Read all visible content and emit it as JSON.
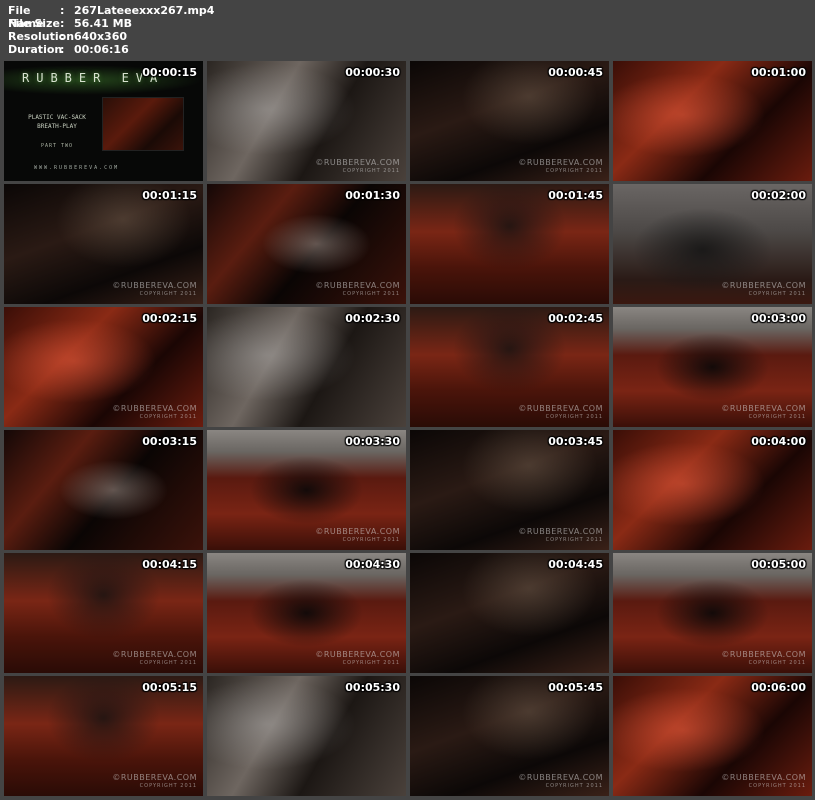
{
  "file_info": {
    "name": {
      "label": "File Name",
      "sep": ":",
      "value": "267Lateeexxx267.mp4"
    },
    "size": {
      "label": "File Size",
      "sep": ":",
      "value": "56.41 MB"
    },
    "resolution": {
      "label": "Resolution",
      "sep": ":",
      "value": "640x360"
    },
    "duration": {
      "label": "Duration",
      "sep": ":",
      "value": "00:06:16"
    }
  },
  "title_card": {
    "logo": "RUBBER EVA",
    "line1": "PLASTIC VAC-SACK",
    "line2": "BREATH-PLAY",
    "part": "PART TWO",
    "url": "WWW.RUBBEREVA.COM"
  },
  "watermark": {
    "brand": "©RUBBEREVA.COM",
    "copyright": "COPYRIGHT 2011"
  },
  "thumbnails": [
    {
      "time": "00:00:15",
      "scene": "title"
    },
    {
      "time": "00:00:30",
      "scene": "plastic"
    },
    {
      "time": "00:00:45",
      "scene": "dark"
    },
    {
      "time": "00:01:00",
      "scene": "red"
    },
    {
      "time": "00:01:15",
      "scene": "dark"
    },
    {
      "time": "00:01:30",
      "scene": "shine"
    },
    {
      "time": "00:01:45",
      "scene": "sofa"
    },
    {
      "time": "00:02:00",
      "scene": "grey"
    },
    {
      "time": "00:02:15",
      "scene": "red"
    },
    {
      "time": "00:02:30",
      "scene": "plastic"
    },
    {
      "time": "00:02:45",
      "scene": "sofa"
    },
    {
      "time": "00:03:00",
      "scene": "wall"
    },
    {
      "time": "00:03:15",
      "scene": "shine"
    },
    {
      "time": "00:03:30",
      "scene": "wall"
    },
    {
      "time": "00:03:45",
      "scene": "dark"
    },
    {
      "time": "00:04:00",
      "scene": "red"
    },
    {
      "time": "00:04:15",
      "scene": "sofa"
    },
    {
      "time": "00:04:30",
      "scene": "wall"
    },
    {
      "time": "00:04:45",
      "scene": "dark"
    },
    {
      "time": "00:05:00",
      "scene": "wall"
    },
    {
      "time": "00:05:15",
      "scene": "sofa"
    },
    {
      "time": "00:05:30",
      "scene": "plastic"
    },
    {
      "time": "00:05:45",
      "scene": "dark"
    },
    {
      "time": "00:06:00",
      "scene": "red"
    }
  ],
  "colors": {
    "background": "#444444",
    "text": "#ffffff",
    "latex_red": "#7a1e10",
    "latex_black": "#0a0605"
  }
}
